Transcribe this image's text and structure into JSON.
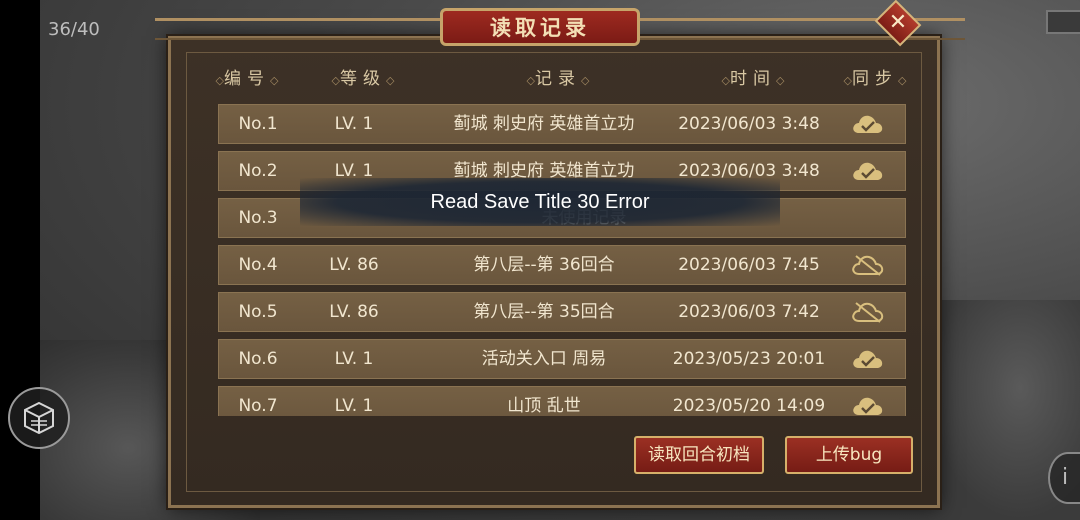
{
  "hud": {
    "page_counter": "36/40"
  },
  "dialog": {
    "title": "读取记录",
    "close_label": "✕"
  },
  "columns": {
    "num": "编号",
    "level": "等级",
    "record": "记录",
    "time": "时间",
    "sync": "同步"
  },
  "rows": [
    {
      "num": "No.1",
      "level": "LV. 1",
      "record": "蓟城 刺史府 英雄首立功",
      "time": "2023/06/03 3:48",
      "sync": "synced-cloud-icon"
    },
    {
      "num": "No.2",
      "level": "LV. 1",
      "record": "蓟城 刺史府 英雄首立功",
      "time": "2023/06/03 3:48",
      "sync": "synced-cloud-icon"
    },
    {
      "num": "No.3",
      "level": "",
      "record": "未使用记录",
      "time": "",
      "sync": ""
    },
    {
      "num": "No.4",
      "level": "LV. 86",
      "record": "第八层--第 36回合",
      "time": "2023/06/03 7:45",
      "sync": "unsynced-cloud-icon"
    },
    {
      "num": "No.5",
      "level": "LV. 86",
      "record": "第八层--第 35回合",
      "time": "2023/06/03 7:42",
      "sync": "unsynced-cloud-icon"
    },
    {
      "num": "No.6",
      "level": "LV. 1",
      "record": "活动关入口 周易",
      "time": "2023/05/23 20:01",
      "sync": "synced-cloud-icon"
    },
    {
      "num": "No.7",
      "level": "LV. 1",
      "record": "山顶 乱世",
      "time": "2023/05/20 14:09",
      "sync": "synced-cloud-icon"
    }
  ],
  "toast": {
    "message": "Read Save Title 30 Error"
  },
  "buttons": {
    "load_initial": "读取回合初档",
    "upload_bug": "上传bug"
  },
  "colors": {
    "row_bg": "#6f5a40",
    "cloud_gold": "#d9bf7e",
    "title_red": "#8c2219"
  }
}
